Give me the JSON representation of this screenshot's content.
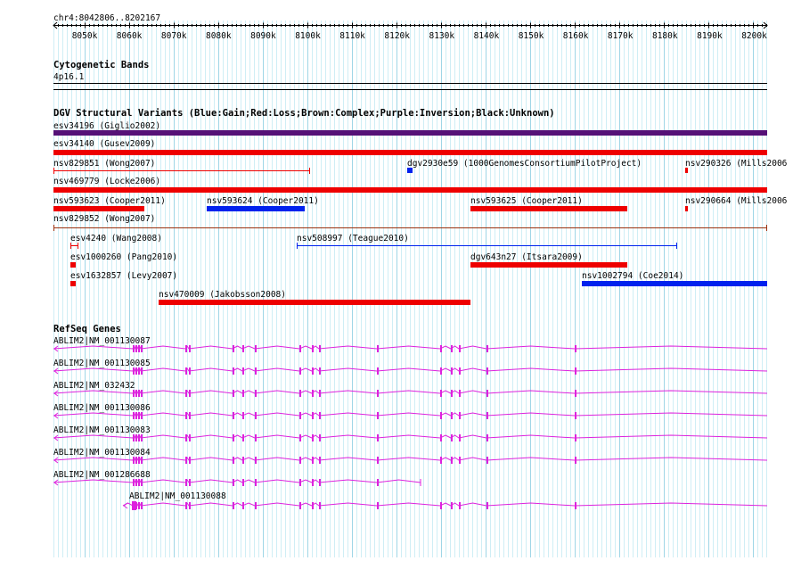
{
  "locus": "chr4:8042806..8202167",
  "ruler": {
    "ticks": [
      "8050k",
      "8060k",
      "8070k",
      "8080k",
      "8090k",
      "8100k",
      "8110k",
      "8120k",
      "8130k",
      "8140k",
      "8150k",
      "8160k",
      "8170k",
      "8180k",
      "8190k",
      "8200k"
    ]
  },
  "cytoband": {
    "title": "Cytogenetic Bands",
    "band": "4p16.1"
  },
  "dgv": {
    "title": "DGV Structural Variants (Blue:Gain;Red:Loss;Brown:Complex;Purple:Inversion;Black:Unknown)",
    "colors": {
      "gain": "#0022ee",
      "loss": "#ee0000",
      "complex": "#993311",
      "inversion": "#551177"
    },
    "features": [
      {
        "label": "esv34196 (Giglio2002)",
        "type": "inversion",
        "style": "bar"
      },
      {
        "label": "esv34140 (Gusev2009)",
        "type": "loss",
        "style": "bar"
      },
      {
        "label": "nsv829851 (Wong2007)",
        "type": "loss",
        "style": "line"
      },
      {
        "label": "dgv2930e59 (1000GenomesConsortiumPilotProject)",
        "type": "gain",
        "style": "bar"
      },
      {
        "label": "nsv290326 (Mills2006",
        "type": "loss",
        "style": "bar"
      },
      {
        "label": "nsv469779 (Locke2006)",
        "type": "loss",
        "style": "bar"
      },
      {
        "label": "nsv593623 (Cooper2011)",
        "type": "loss",
        "style": "bar"
      },
      {
        "label": "nsv593624 (Cooper2011)",
        "type": "gain",
        "style": "bar"
      },
      {
        "label": "nsv593625 (Cooper2011)",
        "type": "loss",
        "style": "bar"
      },
      {
        "label": "nsv290664 (Mills2006",
        "type": "loss",
        "style": "bar"
      },
      {
        "label": "nsv829852 (Wong2007)",
        "type": "complex",
        "style": "line"
      },
      {
        "label": "esv4240 (Wang2008)",
        "type": "loss",
        "style": "line"
      },
      {
        "label": "nsv508997 (Teague2010)",
        "type": "gain",
        "style": "line"
      },
      {
        "label": "esv1000260 (Pang2010)",
        "type": "loss",
        "style": "bar"
      },
      {
        "label": "dgv643n27 (Itsara2009)",
        "type": "loss",
        "style": "bar"
      },
      {
        "label": "esv1632857 (Levy2007)",
        "type": "loss",
        "style": "bar"
      },
      {
        "label": "nsv1002794 (Coe2014)",
        "type": "gain",
        "style": "bar"
      },
      {
        "label": "nsv470009 (Jakobsson2008)",
        "type": "loss",
        "style": "bar"
      }
    ]
  },
  "refseq": {
    "title": "RefSeq Genes",
    "color": "#dd22dd",
    "transcripts": [
      {
        "label": "ABLIM2|NM_001130087"
      },
      {
        "label": "ABLIM2|NM_001130085"
      },
      {
        "label": "ABLIM2|NM_032432"
      },
      {
        "label": "ABLIM2|NM_001130086"
      },
      {
        "label": "ABLIM2|NM_001130083"
      },
      {
        "label": "ABLIM2|NM_001130084"
      },
      {
        "label": "ABLIM2|NM_001286688"
      },
      {
        "label": "ABLIM2|NM_001130088"
      }
    ]
  }
}
